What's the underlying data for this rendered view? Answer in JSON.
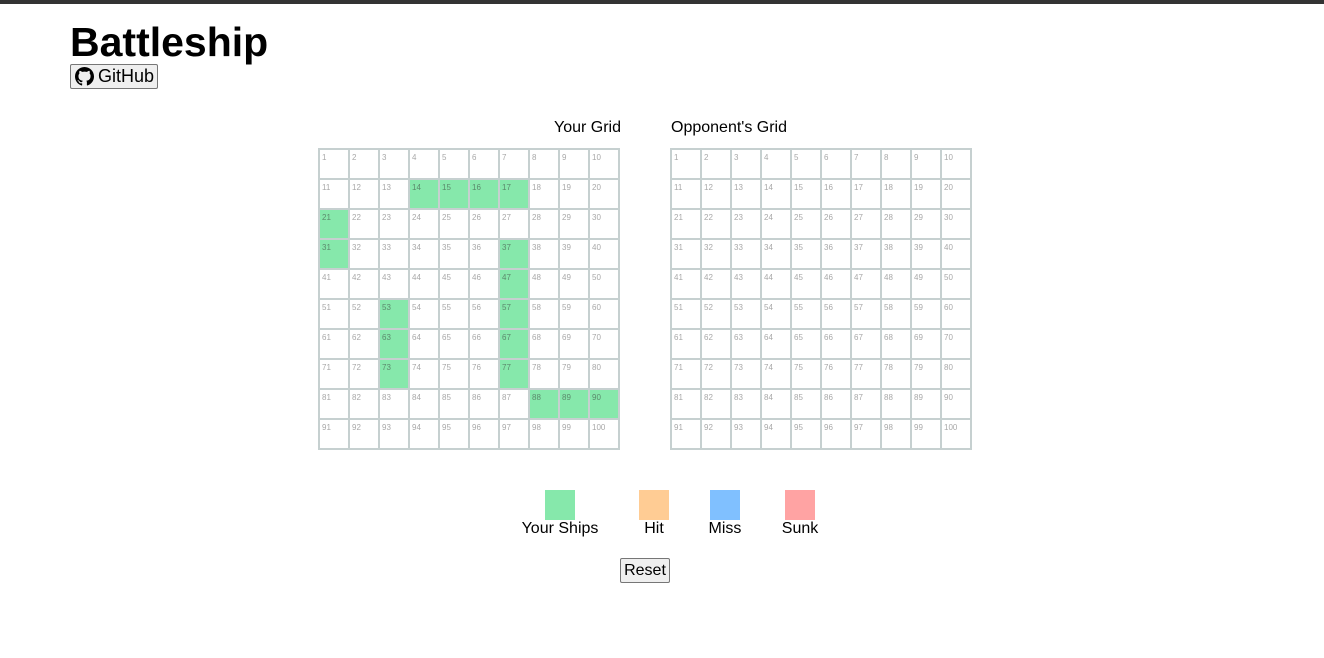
{
  "app": {
    "title": "Battleship",
    "github_label": "GitHub",
    "reset_label": "Reset"
  },
  "grids": {
    "own_label": "Your Grid",
    "opponent_label": "Opponent's Grid",
    "own_ship_cells": [
      14,
      15,
      16,
      17,
      21,
      31,
      37,
      47,
      53,
      57,
      63,
      67,
      73,
      77,
      88,
      89,
      90
    ]
  },
  "legend": [
    {
      "label": "Your Ships",
      "color": "#86e8ab"
    },
    {
      "label": "Hit",
      "color": "#ffcc94"
    },
    {
      "label": "Miss",
      "color": "#80c0ff"
    },
    {
      "label": "Sunk",
      "color": "#ffa3a3"
    }
  ],
  "colors": {
    "ship": "#86e8ab",
    "grid_line": "#c6d0d0",
    "top_bar": "#333333"
  },
  "icons": {
    "github": "github-icon"
  }
}
